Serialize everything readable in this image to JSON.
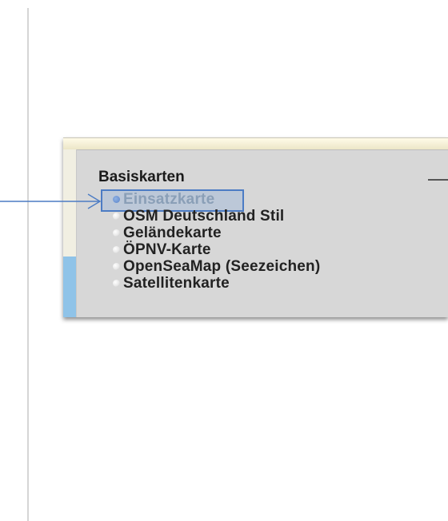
{
  "panel": {
    "title": "Basiskarten",
    "layers": [
      {
        "label": "Einsatzkarte",
        "selected": true
      },
      {
        "label": "OSM Deutschland Stil",
        "selected": false
      },
      {
        "label": "Geländekarte",
        "selected": false
      },
      {
        "label": "ÖPNV-Karte",
        "selected": false
      },
      {
        "label": "OpenSeaMap (Seezeichen)",
        "selected": false
      },
      {
        "label": "Satellitenkarte",
        "selected": false
      }
    ]
  },
  "colors": {
    "highlight": "#4c7cc4",
    "arrow": "#4c7cc4",
    "active_text": "#8a9fb7"
  }
}
